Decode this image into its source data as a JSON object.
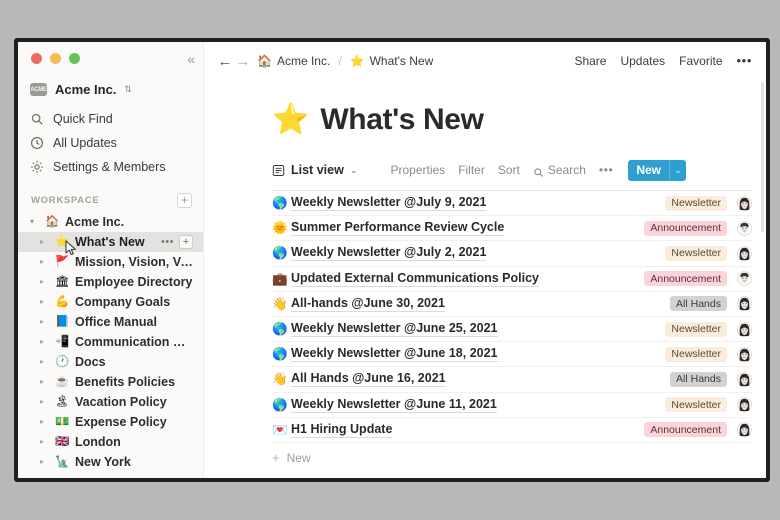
{
  "window": {
    "traffic_lights": [
      "close",
      "minimize",
      "zoom"
    ],
    "collapse_label": "«"
  },
  "sidebar": {
    "workspace_switcher": {
      "name": "Acme Inc.",
      "logo_text": "ACME",
      "caret": "⌃⌄"
    },
    "nav": [
      {
        "label": "Quick Find",
        "icon": "search-icon"
      },
      {
        "label": "All Updates",
        "icon": "clock-icon"
      },
      {
        "label": "Settings & Members",
        "icon": "gear-icon"
      }
    ],
    "section": {
      "title": "WORKSPACE",
      "add_label": "+"
    },
    "tree": [
      {
        "label": "Acme Inc.",
        "emoji": "🏠",
        "depth": 0,
        "twisty": "▾",
        "selected": false
      },
      {
        "label": "What's New",
        "emoji": "⭐",
        "depth": 1,
        "twisty": "▸",
        "selected": true,
        "actions": {
          "more": "•••",
          "add": "+"
        }
      },
      {
        "label": "Mission, Vision, Valu...",
        "emoji": "🚩",
        "depth": 1,
        "twisty": "▸",
        "selected": false
      },
      {
        "label": "Employee Directory",
        "emoji": "🏛",
        "depth": 1,
        "twisty": "▸",
        "selected": false
      },
      {
        "label": "Company Goals",
        "emoji": "💪",
        "depth": 1,
        "twisty": "▸",
        "selected": false
      },
      {
        "label": "Office Manual",
        "emoji": "📘",
        "depth": 1,
        "twisty": "▸",
        "selected": false
      },
      {
        "label": "Communication Play...",
        "emoji": "📲",
        "depth": 1,
        "twisty": "▸",
        "selected": false
      },
      {
        "label": "Docs",
        "emoji": "🕐",
        "depth": 1,
        "twisty": "▸",
        "selected": false
      },
      {
        "label": "Benefits Policies",
        "emoji": "☕",
        "depth": 1,
        "twisty": "▸",
        "selected": false
      },
      {
        "label": "Vacation Policy",
        "emoji": "🏝",
        "depth": 1,
        "twisty": "▸",
        "selected": false
      },
      {
        "label": "Expense Policy",
        "emoji": "💵",
        "depth": 1,
        "twisty": "▸",
        "selected": false
      },
      {
        "label": "London",
        "emoji": "🇬🇧",
        "depth": 1,
        "twisty": "▸",
        "selected": false
      },
      {
        "label": "New York",
        "emoji": "🗽",
        "depth": 1,
        "twisty": "▸",
        "selected": false
      }
    ]
  },
  "topbar": {
    "back": "←",
    "forward": "→",
    "breadcrumb": [
      {
        "emoji": "🏠",
        "label": "Acme Inc."
      },
      {
        "emoji": "⭐",
        "label": "What's New"
      }
    ],
    "separator": "/",
    "actions": [
      "Share",
      "Updates",
      "Favorite"
    ],
    "more": "•••"
  },
  "page": {
    "emoji": "⭐",
    "title": "What's New"
  },
  "db_toolbar": {
    "view_icon": "list-view-icon",
    "view_name": "List view",
    "view_caret": "⌄",
    "links": [
      "Properties",
      "Filter",
      "Sort"
    ],
    "search_label": "Search",
    "more": "•••",
    "new_label": "New",
    "new_caret": "⌄",
    "new_color": "#2f9fd0"
  },
  "tag_colors": {
    "Newsletter": {
      "bg": "#faeddb",
      "fg": "#5c4a30"
    },
    "Announcement": {
      "bg": "#fbd3d9",
      "fg": "#5e3038"
    },
    "All Hands": {
      "bg": "#d3d2d0",
      "fg": "#3c3a37"
    }
  },
  "rows": [
    {
      "emoji": "🌎",
      "title": "Weekly Newsletter @July 9, 2021",
      "tag": "Newsletter",
      "avatar": "avatar-long-hair"
    },
    {
      "emoji": "🌞",
      "title": "Summer Performance Review Cycle",
      "tag": "Announcement",
      "avatar": "avatar-short-hair"
    },
    {
      "emoji": "🌎",
      "title": "Weekly Newsletter @July 2, 2021",
      "tag": "Newsletter",
      "avatar": "avatar-long-hair"
    },
    {
      "emoji": "💼",
      "title": "Updated External Communications Policy",
      "tag": "Announcement",
      "avatar": "avatar-short-hair"
    },
    {
      "emoji": "👋",
      "title": "All-hands @June 30, 2021",
      "tag": "All Hands",
      "avatar": "avatar-long-hair"
    },
    {
      "emoji": "🌎",
      "title": "Weekly Newsletter @June 25, 2021",
      "tag": "Newsletter",
      "avatar": "avatar-long-hair"
    },
    {
      "emoji": "🌎",
      "title": "Weekly Newsletter @June 18, 2021",
      "tag": "Newsletter",
      "avatar": "avatar-long-hair"
    },
    {
      "emoji": "👋",
      "title": "All Hands @June 16, 2021",
      "tag": "All Hands",
      "avatar": "avatar-long-hair"
    },
    {
      "emoji": "🌎",
      "title": "Weekly Newsletter @June 11, 2021",
      "tag": "Newsletter",
      "avatar": "avatar-long-hair"
    },
    {
      "emoji": "💌",
      "title": "H1 Hiring Update",
      "tag": "Announcement",
      "avatar": "avatar-long-hair"
    }
  ],
  "new_row": {
    "plus": "+",
    "label": "New"
  }
}
